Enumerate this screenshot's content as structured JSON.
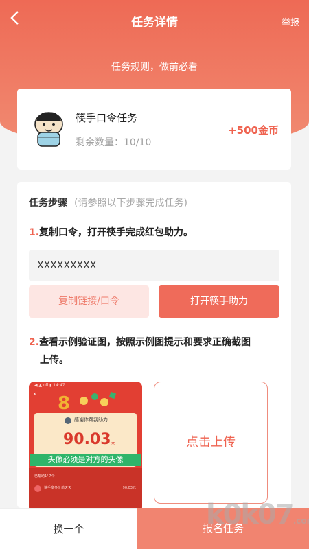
{
  "header": {
    "back_icon": "chevron-left-icon",
    "title": "任务详情",
    "report": "举报",
    "rules_link": "任务规则，做前必看"
  },
  "task": {
    "name": "筷手口令任务",
    "remaining_label": "剩余数量：",
    "remaining_value": "10/10",
    "reward": "+500金币"
  },
  "steps": {
    "heading": "任务步骤",
    "subheading": "(请参照以下步骤完成任务)",
    "step1": {
      "num": "1.",
      "text": "复制口令，打开筷手完成红包助力。"
    },
    "code": "XXXXXXXXX",
    "copy_button": "复制链接/口令",
    "open_button": "打开筷手助力",
    "step2": {
      "num": "2.",
      "text_line1": "查看示例验证图，按照示例图提示和要求正确截图",
      "text_line2": "上传。"
    },
    "example": {
      "status_text": "◀ ▲ ull ▮ 14:47",
      "thanks_text": "感谢你帮我助力",
      "amount": "90.03",
      "unit": "元",
      "banner": "头像必须是对方的头像",
      "helped_text": "已帮助1/ 7个",
      "row_name": "快手多多价值天天",
      "row_amount": "90.03元"
    },
    "upload_label": "点击上传"
  },
  "footer": {
    "swap_button": "换一个",
    "apply_button": "报名任务"
  },
  "watermark": {
    "text": "k0k07",
    "suffix": ".com"
  },
  "colors": {
    "primary": "#ef6350",
    "hero_top": "#ee6a55",
    "light_pink": "#fde6e3",
    "example_red": "#e23f33",
    "example_green": "#2fb56a"
  }
}
